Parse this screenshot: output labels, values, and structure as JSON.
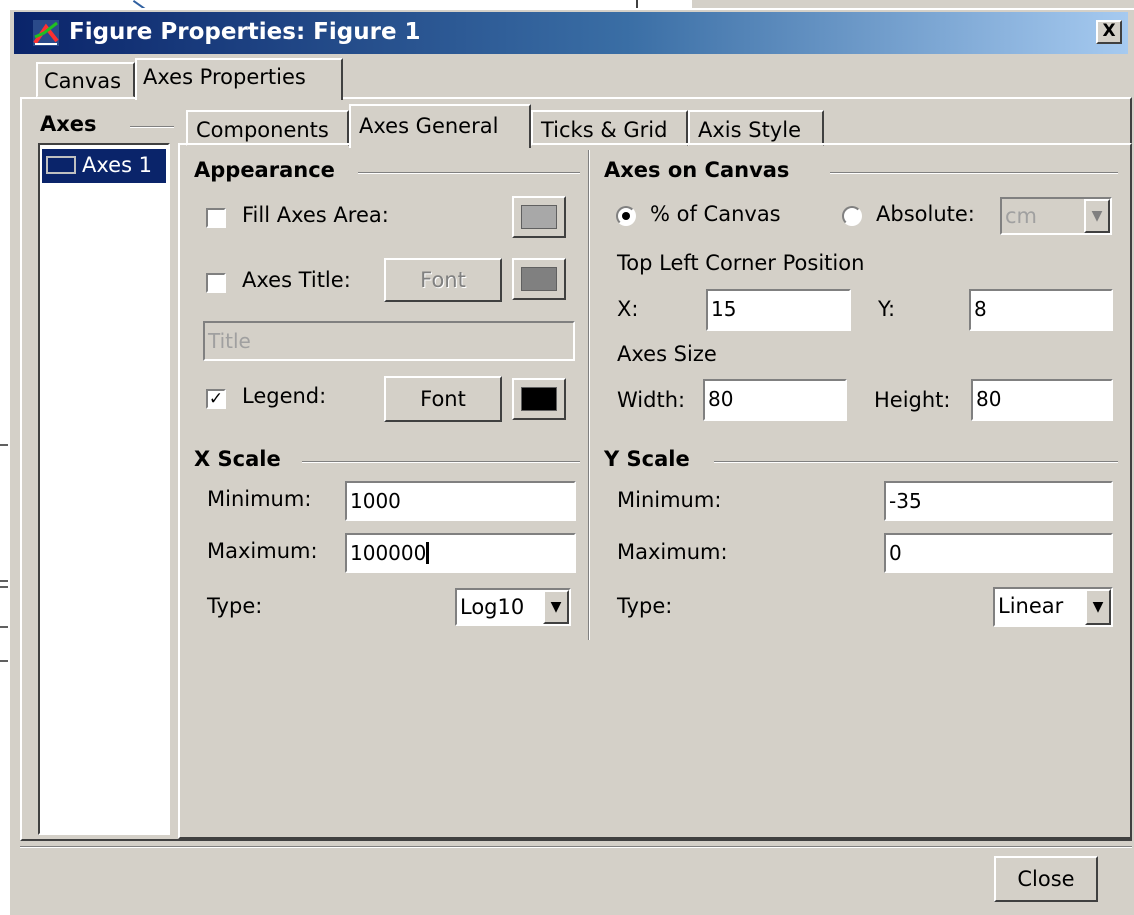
{
  "window": {
    "title": "Figure Properties: Figure 1",
    "close_glyph": "X"
  },
  "outer_tabs": [
    {
      "label": "Canvas"
    },
    {
      "label": "Axes Properties"
    }
  ],
  "axes_list": {
    "title": "Axes",
    "items": [
      {
        "label": "Axes 1"
      }
    ]
  },
  "inner_tabs": [
    {
      "label": "Components"
    },
    {
      "label": "Axes General"
    },
    {
      "label": "Ticks & Grid"
    },
    {
      "label": "Axis Style"
    }
  ],
  "appearance": {
    "title": "Appearance",
    "fill_axes_area": {
      "label": "Fill Axes Area:",
      "checked": false,
      "color": "#a8a8a8"
    },
    "axes_title": {
      "label": "Axes Title:",
      "checked": false,
      "font_label": "Font",
      "color": "#808080",
      "placeholder": "Title"
    },
    "legend": {
      "label": "Legend:",
      "checked": true,
      "check_glyph": "✓",
      "font_label": "Font",
      "color": "#000000"
    }
  },
  "axes_on_canvas": {
    "title": "Axes on Canvas",
    "unit_mode": {
      "percent_label": "% of Canvas",
      "absolute_label": "Absolute:",
      "selected": "percent"
    },
    "unit_select": "cm",
    "top_left_label": "Top Left Corner Position",
    "x_label": "X:",
    "x_value": "15",
    "y_label": "Y:",
    "y_value": "8",
    "size_label": "Axes Size",
    "width_label": "Width:",
    "width_value": "80",
    "height_label": "Height:",
    "height_value": "80"
  },
  "x_scale": {
    "title": "X Scale",
    "min_label": "Minimum:",
    "min_value": "1000",
    "max_label": "Maximum:",
    "max_value": "100000",
    "type_label": "Type:",
    "type_value": "Log10"
  },
  "y_scale": {
    "title": "Y Scale",
    "min_label": "Minimum:",
    "min_value": "-35",
    "max_label": "Maximum:",
    "max_value": "0",
    "type_label": "Type:",
    "type_value": "Linear"
  },
  "footer": {
    "close_label": "Close"
  },
  "icons": {
    "dropdown_arrow": "▼"
  }
}
